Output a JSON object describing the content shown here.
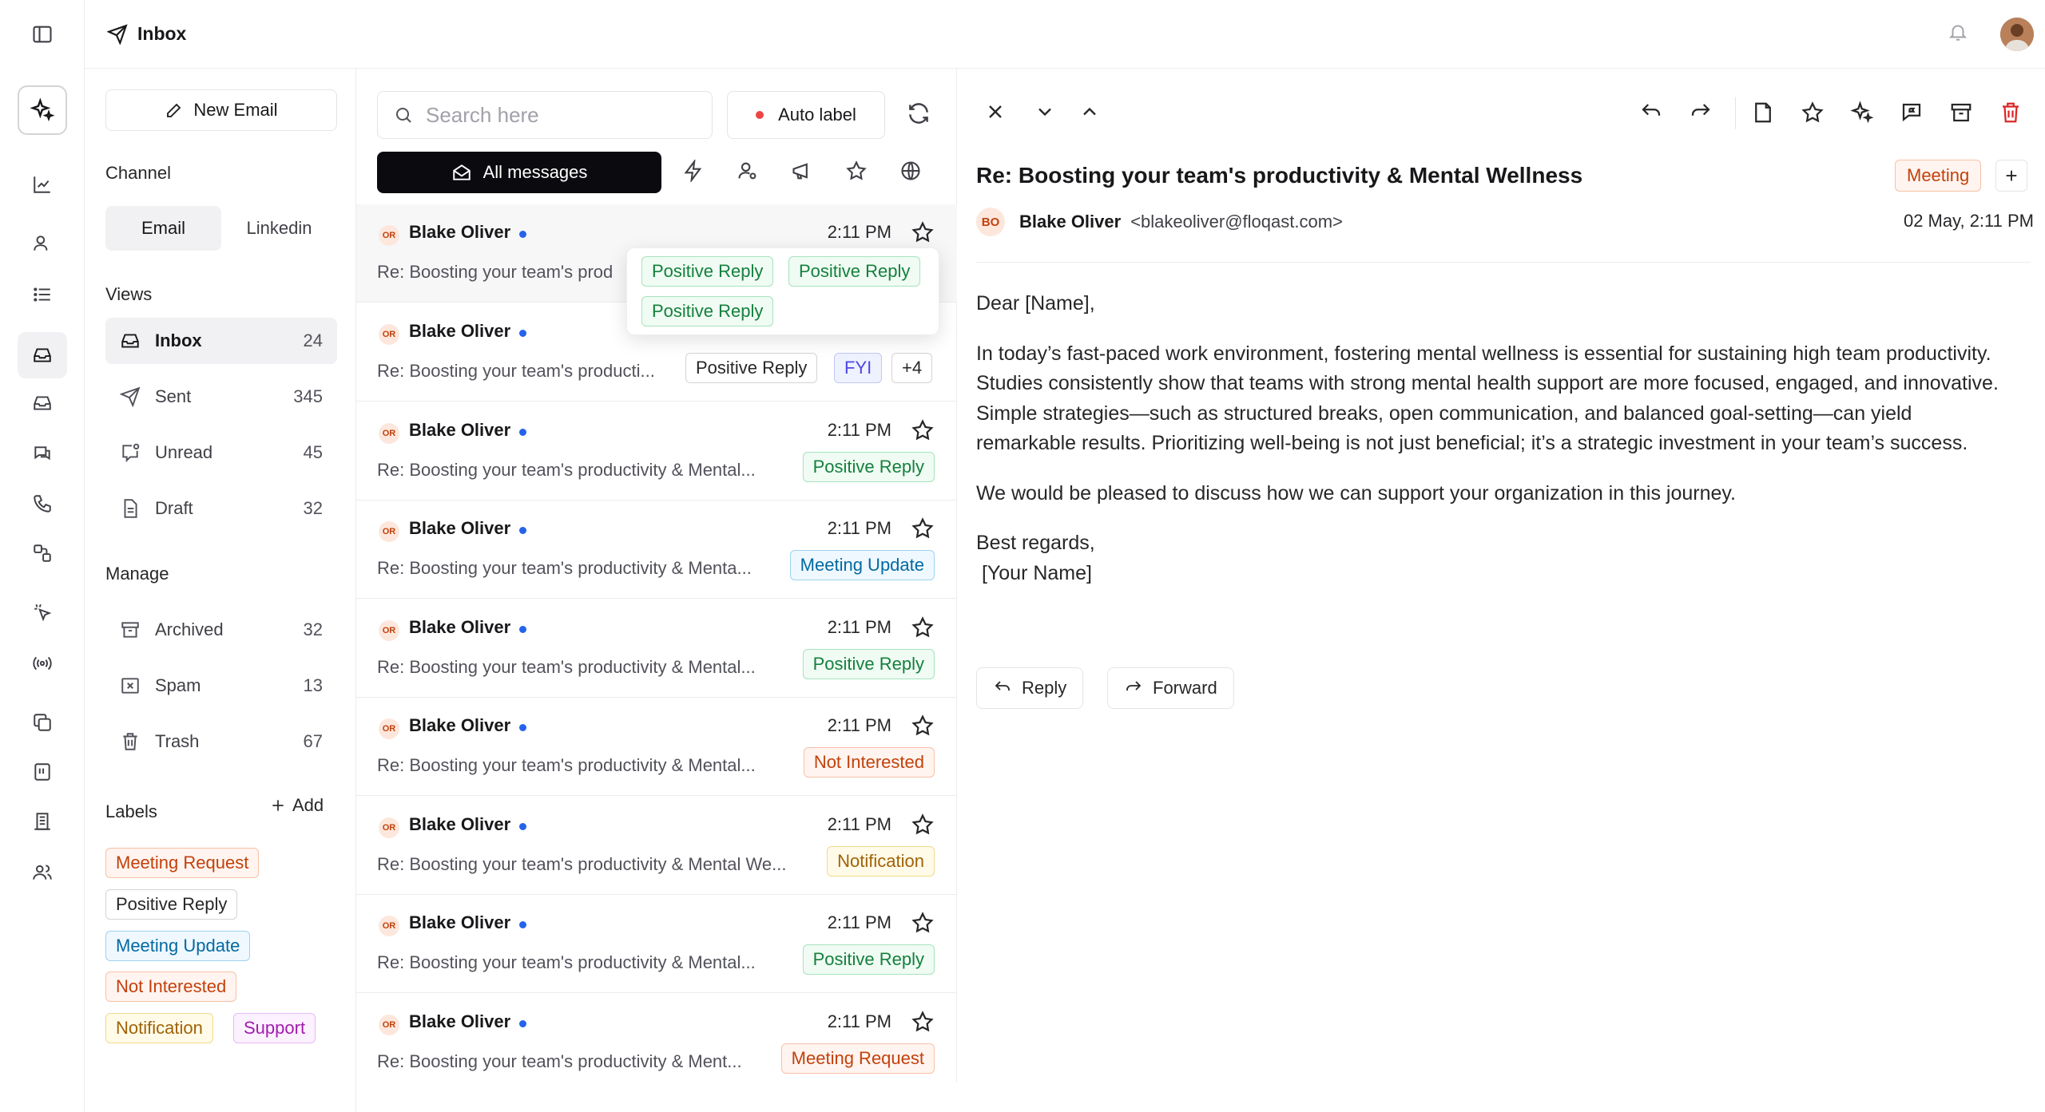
{
  "header": {
    "title": "Inbox"
  },
  "sidebar": {
    "new_email": "New Email",
    "channel_title": "Channel",
    "channels": [
      "Email",
      "Linkedin"
    ],
    "views_title": "Views",
    "views": [
      {
        "label": "Inbox",
        "count": "24"
      },
      {
        "label": "Sent",
        "count": "345"
      },
      {
        "label": "Unread",
        "count": "45"
      },
      {
        "label": "Draft",
        "count": "32"
      }
    ],
    "manage_title": "Manage",
    "manage": [
      {
        "label": "Archived",
        "count": "32"
      },
      {
        "label": "Spam",
        "count": "13"
      },
      {
        "label": "Trash",
        "count": "67"
      }
    ],
    "labels_title": "Labels",
    "add_label": "Add",
    "labels": [
      "Meeting Request",
      "Positive Reply",
      "Meeting Update",
      "Not Interested",
      "Notification",
      "Support"
    ]
  },
  "list": {
    "search_placeholder": "Search here",
    "auto_label": "Auto label",
    "all_messages": "All messages",
    "popup_tags": [
      "Positive Reply",
      "Positive Reply",
      "Positive Reply"
    ],
    "rows": [
      {
        "initials": "OR",
        "sender": "Blake Oliver",
        "time": "2:11 PM",
        "subject": "Re: Boosting your team's prod"
      },
      {
        "initials": "OR",
        "sender": "Blake Oliver",
        "time": "",
        "subject": "Re: Boosting your team's producti...",
        "tags": [
          "Positive Reply",
          "FYI",
          "+4"
        ]
      },
      {
        "initials": "OR",
        "sender": "Blake Oliver",
        "time": "2:11 PM",
        "subject": "Re: Boosting your team's productivity & Mental...",
        "tag": "Positive Reply"
      },
      {
        "initials": "OR",
        "sender": "Blake Oliver",
        "time": "2:11 PM",
        "subject": "Re: Boosting your team's productivity & Menta...",
        "tag": "Meeting Update"
      },
      {
        "initials": "OR",
        "sender": "Blake Oliver",
        "time": "2:11 PM",
        "subject": "Re: Boosting your team's productivity & Mental...",
        "tag": "Positive Reply"
      },
      {
        "initials": "OR",
        "sender": "Blake Oliver",
        "time": "2:11 PM",
        "subject": "Re: Boosting your team's productivity & Mental...",
        "tag": "Not Interested"
      },
      {
        "initials": "OR",
        "sender": "Blake Oliver",
        "time": "2:11 PM",
        "subject": "Re: Boosting your team's productivity & Mental We...",
        "tag": "Notification"
      },
      {
        "initials": "OR",
        "sender": "Blake Oliver",
        "time": "2:11 PM",
        "subject": "Re: Boosting your team's productivity & Mental...",
        "tag": "Positive Reply"
      },
      {
        "initials": "OR",
        "sender": "Blake Oliver",
        "time": "2:11 PM",
        "subject": "Re: Boosting your team's productivity & Ment...",
        "tag": "Meeting Request"
      }
    ]
  },
  "reader": {
    "subject": "Re: Boosting your team's productivity & Mental Wellness",
    "tag": "Meeting",
    "plus": "+",
    "sender_initials": "BO",
    "sender_name": "Blake Oliver",
    "sender_email": "<blakeoliver@floqast.com>",
    "date": "02 May, 2:11 PM",
    "greeting": "Dear [Name],",
    "para1": "In today’s fast-paced work environment, fostering mental wellness is essential for sustaining high team productivity. Studies consistently show that teams with strong mental health support are more focused, engaged, and innovative. Simple strategies—such as structured breaks, open communication, and balanced goal-setting—can yield remarkable results. Prioritizing well-being is not just beneficial; it’s a strategic investment in your team’s success.",
    "para2": "We would be pleased to discuss how we can support your organization in this journey.",
    "closing": "Best regards,",
    "signature": " [Your Name]",
    "reply": "Reply",
    "forward": "Forward"
  }
}
